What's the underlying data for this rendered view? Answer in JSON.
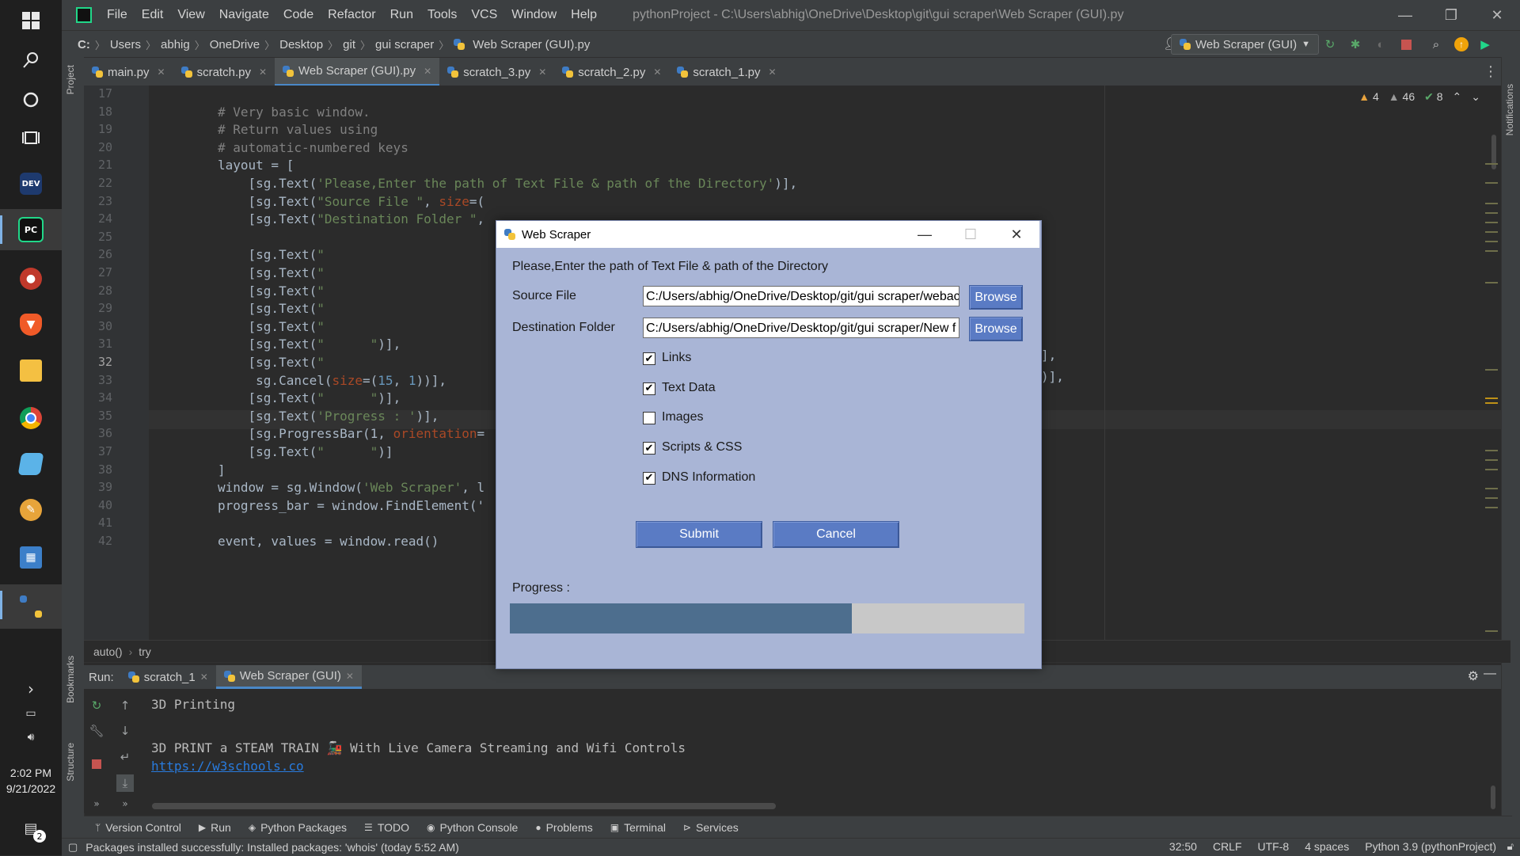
{
  "ide": {
    "menu": [
      "File",
      "Edit",
      "View",
      "Navigate",
      "Code",
      "Refactor",
      "Run",
      "Tools",
      "VCS",
      "Window",
      "Help"
    ],
    "window_title": "pythonProject - C:\\Users\\abhig\\OneDrive\\Desktop\\git\\gui scraper\\Web Scraper (GUI).py",
    "breadcrumbs": [
      "C:",
      "Users",
      "abhig",
      "OneDrive",
      "Desktop",
      "git",
      "gui scraper",
      "Web Scraper (GUI).py"
    ],
    "run_config": "Web Scraper (GUI)",
    "tabs": [
      {
        "label": "main.py"
      },
      {
        "label": "scratch.py"
      },
      {
        "label": "Web Scraper (GUI).py",
        "active": true
      },
      {
        "label": "scratch_3.py"
      },
      {
        "label": "scratch_2.py"
      },
      {
        "label": "scratch_1.py"
      }
    ],
    "inspections": {
      "warnings": "4",
      "weak_warnings": "46",
      "ok": "8"
    },
    "side_left": [
      "Project",
      "Bookmarks",
      "Structure"
    ],
    "side_right": [
      "Notifications"
    ]
  },
  "editor": {
    "current_line": "32",
    "lines": [
      {
        "n": "17",
        "c": ""
      },
      {
        "n": "18",
        "c": "# Very basic window."
      },
      {
        "n": "19",
        "c": "# Return values using"
      },
      {
        "n": "20",
        "c": "# automatic-numbered keys"
      },
      {
        "n": "21",
        "c": "layout = ["
      },
      {
        "n": "22",
        "c": "    [sg.Text('Please,Enter the path of Text File & path of the Directory')],"
      },
      {
        "n": "23",
        "c": "    [sg.Text(\"Source File \", size=("
      },
      {
        "n": "24",
        "c": "    [sg.Text(\"Destination Folder \","
      },
      {
        "n": "25",
        "c": ""
      },
      {
        "n": "26",
        "c": "    [sg.Text(\""
      },
      {
        "n": "27",
        "c": "    [sg.Text(\""
      },
      {
        "n": "28",
        "c": "    [sg.Text(\""
      },
      {
        "n": "29",
        "c": "    [sg.Text(\""
      },
      {
        "n": "30",
        "c": "    [sg.Text(\""
      },
      {
        "n": "31",
        "c": "    [sg.Text(\"      \")],"
      },
      {
        "n": "32",
        "c": "    [sg.Text(\""
      },
      {
        "n": "33",
        "c": "     sg.Cancel(size=(15, 1))],"
      },
      {
        "n": "34",
        "c": "    [sg.Text(\"      \")],"
      },
      {
        "n": "35",
        "c": "    [sg.Text('Progress : ')],"
      },
      {
        "n": "36",
        "c": "    [sg.ProgressBar(1, orientation="
      },
      {
        "n": "37",
        "c": "    [sg.Text(\"      \")]"
      },
      {
        "n": "38",
        "c": "]"
      },
      {
        "n": "39",
        "c": "window = sg.Window('Web Scraper', l"
      },
      {
        "n": "40",
        "c": "progress_bar = window.FindElement('"
      },
      {
        "n": "41",
        "c": ""
      },
      {
        "n": "42",
        "c": "event, values = window.read()"
      }
    ],
    "overflow_right": {
      "line29": "],",
      "line30": ")],"
    },
    "crumbs": [
      "auto()",
      "try"
    ]
  },
  "run": {
    "label": "Run:",
    "tabs": [
      {
        "label": "scratch_1"
      },
      {
        "label": "Web Scraper (GUI)",
        "active": true
      }
    ],
    "output": [
      "3D Printing",
      "",
      "3D PRINT a STEAM TRAIN 🚂 With Live Camera Streaming and Wifi Controls"
    ],
    "link": "https://w3schools.co"
  },
  "bottom_tabs": [
    "Version Control",
    "Run",
    "Python Packages",
    "TODO",
    "Python Console",
    "Problems",
    "Terminal",
    "Services"
  ],
  "status": {
    "message": "Packages installed successfully: Installed packages: 'whois' (today 5:52 AM)",
    "position": "32:50",
    "line_sep": "CRLF",
    "encoding": "UTF-8",
    "indent": "4 spaces",
    "interpreter": "Python 3.9 (pythonProject)"
  },
  "taskbar": {
    "time": "2:02 PM",
    "date": "9/21/2022",
    "notif_count": "2",
    "dev_label": "DEV",
    "pc_label": "PC"
  },
  "dialog": {
    "title": "Web Scraper",
    "prompt": "Please,Enter the path of Text File & path of the Directory",
    "source_label": "Source File",
    "source_value": "C:/Users/abhig/OneDrive/Desktop/git/gui scraper/webac",
    "dest_label": "Destination Folder",
    "dest_value": "C:/Users/abhig/OneDrive/Desktop/git/gui scraper/New f",
    "browse_label": "Browse",
    "options": [
      {
        "label": "Links",
        "checked": true
      },
      {
        "label": "Text Data",
        "checked": true
      },
      {
        "label": "Images",
        "checked": false
      },
      {
        "label": "Scripts & CSS",
        "checked": true
      },
      {
        "label": "DNS Information",
        "checked": true
      }
    ],
    "submit_label": "Submit",
    "cancel_label": "Cancel",
    "progress_label": "Progress :",
    "progress": 0.665
  },
  "colors": {
    "accent": "#4a88c7",
    "dialog_bg": "#a9b5d6",
    "button": "#5a7bc4",
    "progress_fill": "#4d6e8e"
  }
}
